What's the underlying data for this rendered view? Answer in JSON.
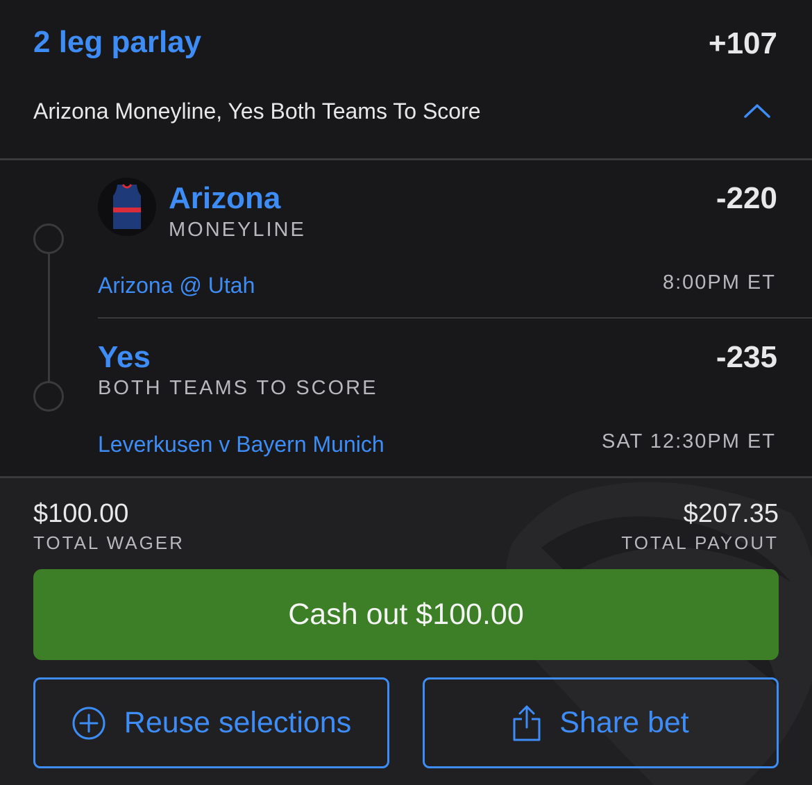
{
  "parlay": {
    "title": "2 leg parlay",
    "odds": "+107",
    "summary": "Arizona Moneyline, Yes Both Teams To Score"
  },
  "legs": [
    {
      "selection": "Arizona",
      "market": "MONEYLINE",
      "odds": "-220",
      "event": "Arizona @ Utah",
      "time": "8:00PM ET",
      "icon": "jersey-icon"
    },
    {
      "selection": "Yes",
      "market": "BOTH TEAMS TO SCORE",
      "odds": "-235",
      "event": "Leverkusen v Bayern Munich",
      "time": "SAT 12:30PM ET"
    }
  ],
  "totals": {
    "wager_amount": "$100.00",
    "wager_label": "TOTAL WAGER",
    "payout_amount": "$207.35",
    "payout_label": "TOTAL PAYOUT"
  },
  "actions": {
    "cashout_label": "Cash out $100.00",
    "reuse_label": "Reuse selections",
    "share_label": "Share bet"
  },
  "colors": {
    "accent": "#3e8cf5",
    "cashout_green": "#3c7f26",
    "background": "#18181a",
    "footer_background": "#202023"
  }
}
